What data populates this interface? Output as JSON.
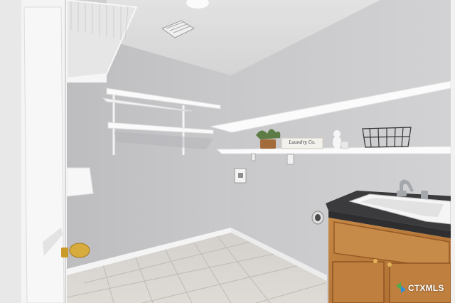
{
  "photo": {
    "subject": "laundry-room",
    "sign_text": "Laundry Co.",
    "watermark_text": "CTXMLS"
  },
  "colors": {
    "wall": "#c6c6c8",
    "ceiling": "#dcdcdc",
    "tile": "#d8d5d0",
    "door": "#f5f5f5",
    "cabinet": "#b8793a",
    "countertop": "#3d3d3f",
    "shelf": "#ffffff",
    "brass": "#d4a536",
    "watermark_green": "#4cae4c",
    "watermark_blue": "#2f8ed8"
  }
}
